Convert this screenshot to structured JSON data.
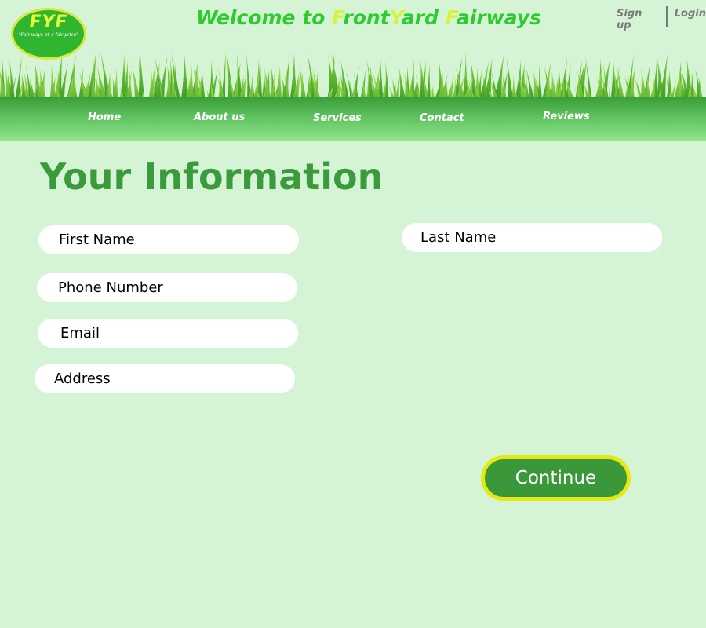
{
  "header": {
    "logo": {
      "initials": "FYF",
      "tagline": "\"Fair ways at a fair price\""
    },
    "title": {
      "prefix": "Welcome to ",
      "f1": "F",
      "w1": "ront",
      "y": "Y",
      "w2": "ard ",
      "f2": "F",
      "w3": "airways"
    },
    "auth": {
      "signup": "Sign up",
      "login": "Login"
    },
    "nav": {
      "home": "Home",
      "about": "About us",
      "services": "Services",
      "contact": "Contact",
      "reviews": "Reviews"
    }
  },
  "main": {
    "title": "Your Information",
    "fields": {
      "first_name": "First Name",
      "last_name": "Last Name",
      "phone": "Phone Number",
      "email": "Email",
      "address": "Address"
    },
    "continue_label": "Continue"
  },
  "colors": {
    "background": "#d5f4d6",
    "primary_green": "#3b9a3b",
    "title_green": "#2ecb2e",
    "highlight_yellow": "#d8f23a",
    "button_border": "#e6e812"
  },
  "icons": {
    "logo": "fyf-logo",
    "decoration": "grass-banner"
  }
}
